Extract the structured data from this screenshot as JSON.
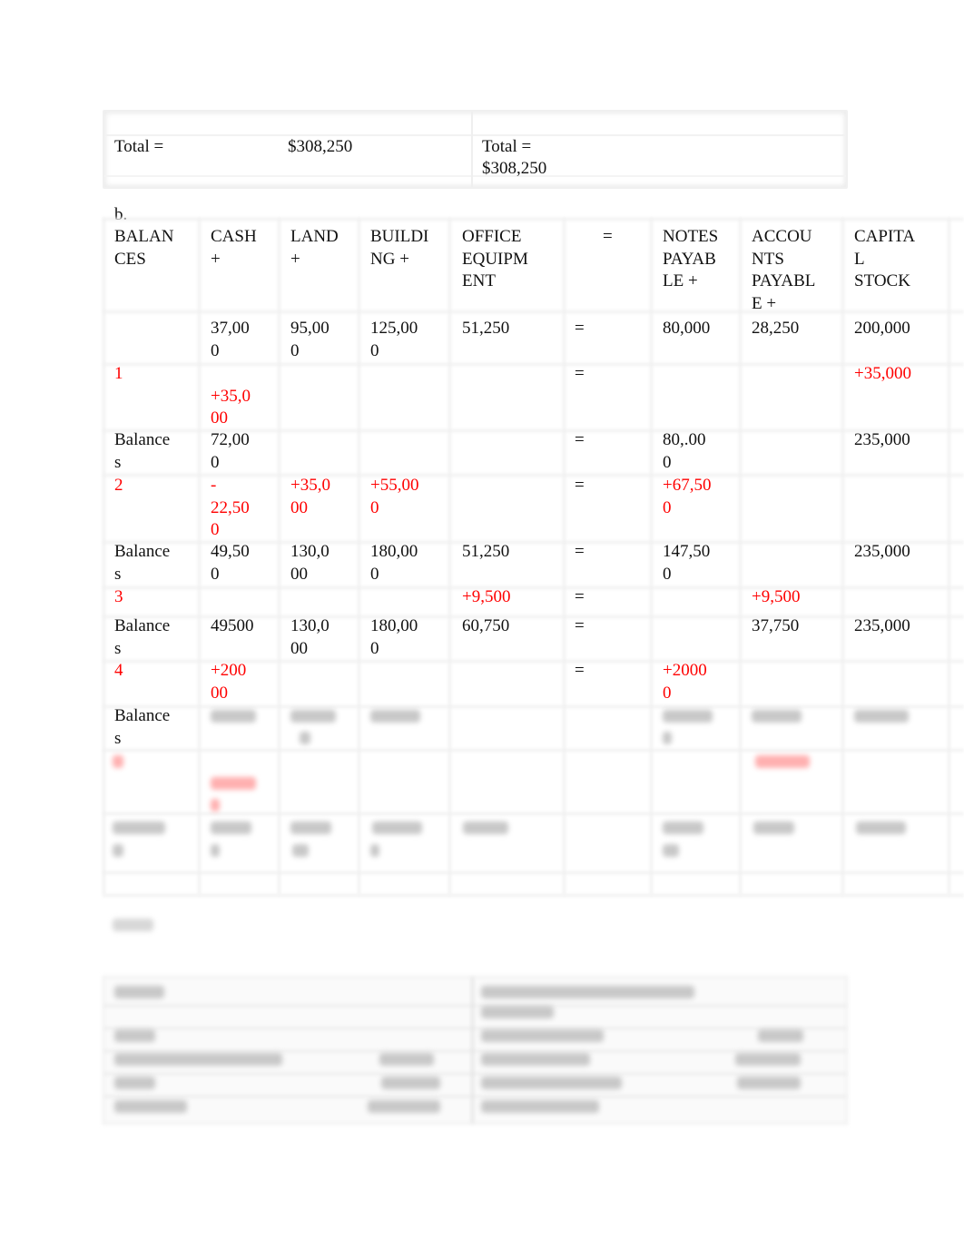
{
  "totals": {
    "left_label": "Total =",
    "left_value": "$308,250",
    "right_label": "Total =",
    "right_value": "$308,250"
  },
  "section_b": {
    "label": "b.",
    "headers": [
      [
        "BALAN",
        "CES"
      ],
      [
        "CASH",
        "+"
      ],
      [
        "LAND",
        "+"
      ],
      [
        "BUILDI",
        "NG +"
      ],
      [
        "OFFICE",
        "EQUIPM",
        "ENT"
      ],
      [
        "="
      ],
      [
        "NOTES",
        "PAYAB",
        "LE +"
      ],
      [
        "ACCOU",
        "NTS",
        "PAYABL",
        "E +"
      ],
      [
        "CAPITA",
        "L",
        "STOCK"
      ]
    ],
    "rows": [
      {
        "kind": "balance",
        "cells": [
          [
            ""
          ],
          [
            "37,00",
            "0"
          ],
          [
            "95,00",
            "0"
          ],
          [
            "125,00",
            "0"
          ],
          [
            "51,250"
          ],
          [
            "="
          ],
          [
            "80,000"
          ],
          [
            "28,250"
          ],
          [
            "200,000"
          ]
        ]
      },
      {
        "kind": "transaction",
        "cells": [
          [
            "1"
          ],
          [
            "",
            "+35,0",
            "00"
          ],
          [
            ""
          ],
          [
            ""
          ],
          [
            ""
          ],
          [
            "="
          ],
          [
            ""
          ],
          [
            ""
          ],
          [
            "+35,000"
          ]
        ]
      },
      {
        "kind": "balance",
        "cells": [
          [
            "Balance",
            "s"
          ],
          [
            "72,00",
            "0"
          ],
          [
            ""
          ],
          [
            ""
          ],
          [
            ""
          ],
          [
            "="
          ],
          [
            "80,.00",
            "0"
          ],
          [
            ""
          ],
          [
            "235,000"
          ]
        ]
      },
      {
        "kind": "transaction",
        "cells": [
          [
            "2"
          ],
          [
            "-",
            "22,50",
            "0"
          ],
          [
            "+35,0",
            "00"
          ],
          [
            "+55,00",
            "0"
          ],
          [
            ""
          ],
          [
            "="
          ],
          [
            "+67,50",
            "0"
          ],
          [
            ""
          ],
          [
            ""
          ]
        ]
      },
      {
        "kind": "balance",
        "cells": [
          [
            "Balance",
            "s"
          ],
          [
            "49,50",
            "0"
          ],
          [
            "130,0",
            "00"
          ],
          [
            "180,00",
            "0"
          ],
          [
            "51,250"
          ],
          [
            "="
          ],
          [
            "147,50",
            "0"
          ],
          [
            ""
          ],
          [
            "235,000"
          ]
        ]
      },
      {
        "kind": "transaction",
        "cells": [
          [
            "3"
          ],
          [
            ""
          ],
          [
            ""
          ],
          [
            ""
          ],
          [
            "+9,500"
          ],
          [
            "="
          ],
          [
            ""
          ],
          [
            "+9,500"
          ],
          [
            ""
          ]
        ]
      },
      {
        "kind": "balance",
        "cells": [
          [
            "Balance",
            "s"
          ],
          [
            "49500"
          ],
          [
            "130,0",
            "00"
          ],
          [
            "180,00",
            "0"
          ],
          [
            "60,750"
          ],
          [
            "="
          ],
          [
            ""
          ],
          [
            "37,750"
          ],
          [
            "235,000"
          ]
        ]
      },
      {
        "kind": "transaction",
        "cells": [
          [
            "4"
          ],
          [
            "+200",
            "00"
          ],
          [
            ""
          ],
          [
            ""
          ],
          [
            ""
          ],
          [
            "="
          ],
          [
            "+2000",
            "0"
          ],
          [
            ""
          ],
          [
            ""
          ]
        ]
      },
      {
        "kind": "balance",
        "cells": [
          [
            "Balance",
            "s"
          ]
        ]
      }
    ]
  }
}
